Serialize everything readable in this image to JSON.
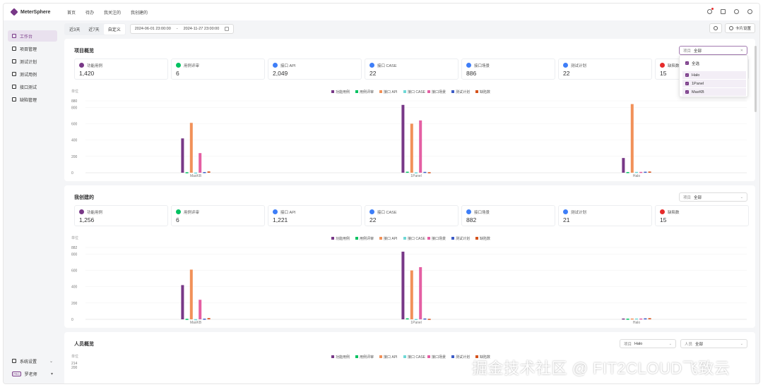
{
  "app": {
    "logo_text": "MeterSphere",
    "nav": [
      "首页",
      "待办",
      "我关注的",
      "我创建的"
    ]
  },
  "sidebar": {
    "items": [
      {
        "label": "工作台",
        "active": true
      },
      {
        "label": "项目管理",
        "active": false
      },
      {
        "label": "测试计划",
        "active": false
      },
      {
        "label": "测试用例",
        "active": false
      },
      {
        "label": "接口测试",
        "active": false
      },
      {
        "label": "缺陷管理",
        "active": false
      }
    ],
    "system_settings": "系统设置",
    "user_name": "罗老师",
    "user_tag": "PRO"
  },
  "filterbar": {
    "tabs": [
      {
        "label": "近3天",
        "active": false
      },
      {
        "label": "近7天",
        "active": false
      },
      {
        "label": "自定义",
        "active": true
      }
    ],
    "date_start": "2024-06-01 23:00:00",
    "date_sep": "-",
    "date_end": "2024-11-27 23:00:00",
    "card_settings": "卡片设置"
  },
  "series_legend": [
    {
      "name": "功能用例",
      "color": "#783887"
    },
    {
      "name": "用例评审",
      "color": "#00c261"
    },
    {
      "name": "接口 API",
      "color": "#f19159"
    },
    {
      "name": "接口 CASE",
      "color": "#6fd8d6"
    },
    {
      "name": "接口场景",
      "color": "#e45fa3"
    },
    {
      "name": "测试计划",
      "color": "#3d5cc6"
    },
    {
      "name": "缺陷数",
      "color": "#d5521b"
    }
  ],
  "project_overview": {
    "title": "项目概览",
    "select_prefix": "项目",
    "select_value": "全部",
    "stats": [
      {
        "label": "功能用例",
        "value": "1,420",
        "color": "#783887"
      },
      {
        "label": "用例评审",
        "value": "6",
        "color": "#00c261"
      },
      {
        "label": "接口 API",
        "value": "2,049",
        "color": "#3e7ef8"
      },
      {
        "label": "接口 CASE",
        "value": "22",
        "color": "#3e7ef8"
      },
      {
        "label": "接口场景",
        "value": "886",
        "color": "#3e7ef8"
      },
      {
        "label": "测试计划",
        "value": "22",
        "color": "#3e7ef8"
      },
      {
        "label": "缺陷数",
        "value": "15",
        "color": "#e62b2b"
      }
    ],
    "dropdown": {
      "items": [
        {
          "label": "全选",
          "checked": true
        },
        {
          "label": "Halo",
          "checked": true
        },
        {
          "label": "1Panel",
          "checked": true
        },
        {
          "label": "MaxKB",
          "checked": true
        }
      ]
    }
  },
  "my_created": {
    "title": "我创建的",
    "select_prefix": "项目",
    "select_value": "全部",
    "stats": [
      {
        "label": "功能用例",
        "value": "1,256",
        "color": "#783887"
      },
      {
        "label": "用例评审",
        "value": "6",
        "color": "#00c261"
      },
      {
        "label": "接口 API",
        "value": "1,221",
        "color": "#3e7ef8"
      },
      {
        "label": "接口 CASE",
        "value": "22",
        "color": "#3e7ef8"
      },
      {
        "label": "接口场景",
        "value": "882",
        "color": "#3e7ef8"
      },
      {
        "label": "测试计划",
        "value": "21",
        "color": "#3e7ef8"
      },
      {
        "label": "缺陷数",
        "value": "15",
        "color": "#e62b2b"
      }
    ]
  },
  "member_overview": {
    "title": "人员概览",
    "project_prefix": "项目",
    "project_value": "Halo",
    "member_prefix": "人员",
    "member_value": "全部"
  },
  "watermark": "掘金技术社区 @ FIT2CLOUD飞致云",
  "chart_data": [
    {
      "type": "bar",
      "ylabel": "单位",
      "yticks": [
        0,
        200,
        400,
        600,
        800,
        880
      ],
      "ylim": [
        0,
        880
      ],
      "categories": [
        "MaxKB",
        "1Panel",
        "Halo"
      ],
      "series": [
        {
          "name": "功能用例",
          "values": [
            420,
            830,
            180
          ]
        },
        {
          "name": "用例评审",
          "values": [
            6,
            12,
            8
          ]
        },
        {
          "name": "接口 API",
          "values": [
            610,
            600,
            840
          ]
        },
        {
          "name": "接口 CASE",
          "values": [
            2,
            4,
            10
          ]
        },
        {
          "name": "接口场景",
          "values": [
            240,
            640,
            10
          ]
        },
        {
          "name": "测试计划",
          "values": [
            8,
            10,
            12
          ]
        },
        {
          "name": "缺陷数",
          "values": [
            15,
            6,
            14
          ]
        }
      ]
    },
    {
      "type": "bar",
      "ylabel": "单位",
      "yticks": [
        0,
        200,
        400,
        600,
        800,
        882
      ],
      "ylim": [
        0,
        882
      ],
      "categories": [
        "MaxKB",
        "1Panel",
        "Halo"
      ],
      "series": [
        {
          "name": "功能用例",
          "values": [
            420,
            830,
            10
          ]
        },
        {
          "name": "用例评审",
          "values": [
            6,
            12,
            8
          ]
        },
        {
          "name": "接口 API",
          "values": [
            610,
            600,
            10
          ]
        },
        {
          "name": "接口 CASE",
          "values": [
            2,
            4,
            10
          ]
        },
        {
          "name": "接口场景",
          "values": [
            240,
            640,
            10
          ]
        },
        {
          "name": "测试计划",
          "values": [
            8,
            10,
            12
          ]
        },
        {
          "name": "缺陷数",
          "values": [
            15,
            6,
            14
          ]
        }
      ]
    },
    {
      "type": "bar",
      "ylabel": "单位",
      "yticks": [
        200,
        214
      ],
      "categories": [],
      "series": []
    }
  ]
}
